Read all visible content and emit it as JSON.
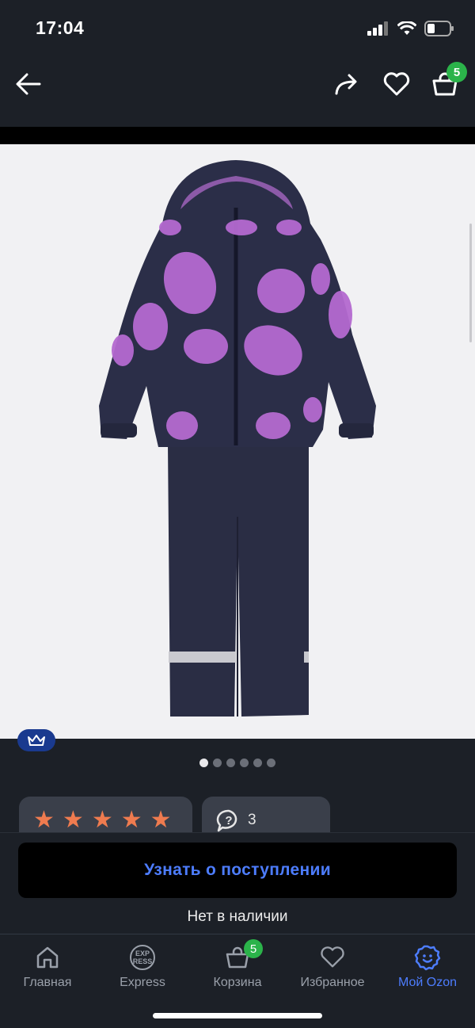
{
  "status_bar": {
    "time": "17:04"
  },
  "header": {
    "cart_count": "5"
  },
  "gallery": {
    "total_images": 6,
    "active_index": 0
  },
  "rating": {
    "stars_filled": 5,
    "stars_total": 5,
    "star_color": "#ef7b4f"
  },
  "questions": {
    "count": "3"
  },
  "actions": {
    "notify_label": "Узнать о поступлении",
    "availability": "Нет в наличии"
  },
  "tabs": [
    {
      "label": "Главная",
      "icon": "home-icon"
    },
    {
      "label": "Express",
      "icon": "express-icon"
    },
    {
      "label": "Корзина",
      "icon": "cart-icon",
      "badge": "5"
    },
    {
      "label": "Избранное",
      "icon": "heart-icon"
    },
    {
      "label": "Мой Ozon",
      "icon": "profile-smile-icon",
      "active": true
    }
  ],
  "colors": {
    "accent": "#4d7dff",
    "badge": "#2bb34a",
    "background": "#1c2027"
  }
}
